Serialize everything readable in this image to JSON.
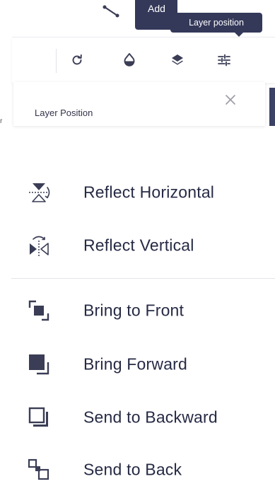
{
  "top": {
    "add_tooltip": "Add",
    "layer_tooltip": "Layer position"
  },
  "toolbar": {
    "buttons": [
      {
        "name": "rotate-button",
        "icon": "rotate-icon"
      },
      {
        "name": "opacity-button",
        "icon": "droplet-icon"
      },
      {
        "name": "layers-button",
        "icon": "layers-icon"
      },
      {
        "name": "layer-position-button",
        "icon": "sliders-icon"
      }
    ]
  },
  "panel": {
    "title": "Layer Position",
    "left_mark": "r",
    "close_icon": "close-icon"
  },
  "menu": {
    "items": [
      {
        "label": "Reflect Horizontal",
        "icon": "reflect-horizontal-icon"
      },
      {
        "label": "Reflect Vertical",
        "icon": "reflect-vertical-icon"
      },
      {
        "label": "Bring to Front",
        "icon": "bring-to-front-icon"
      },
      {
        "label": "Bring Forward",
        "icon": "bring-forward-icon"
      },
      {
        "label": "Send to Backward",
        "icon": "send-backward-icon"
      },
      {
        "label": "Send to Back",
        "icon": "send-to-back-icon"
      }
    ]
  },
  "colors": {
    "tooltip_bg": "#34395a",
    "text": "#262a44",
    "icon": "#3a3d55"
  }
}
